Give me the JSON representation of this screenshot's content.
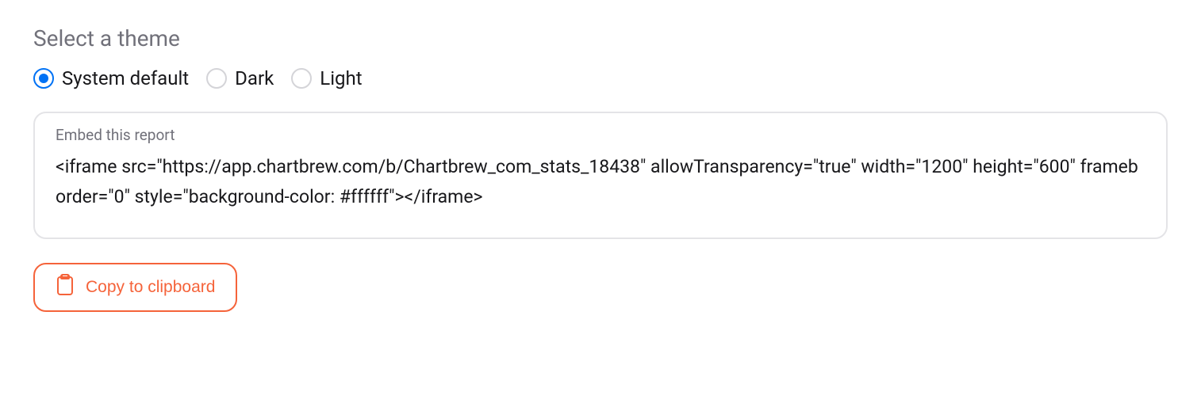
{
  "heading": "Select a theme",
  "themes": {
    "options": [
      {
        "label": "System default",
        "selected": true
      },
      {
        "label": "Dark",
        "selected": false
      },
      {
        "label": "Light",
        "selected": false
      }
    ]
  },
  "embed": {
    "label": "Embed this report",
    "code": "<iframe src=\"https://app.chartbrew.com/b/Chartbrew_com_stats_18438\" allowTransparency=\"true\" width=\"1200\" height=\"600\" frameborder=\"0\" style=\"background-color: #ffffff\"></iframe>"
  },
  "copy_button": {
    "label": "Copy to clipboard"
  }
}
